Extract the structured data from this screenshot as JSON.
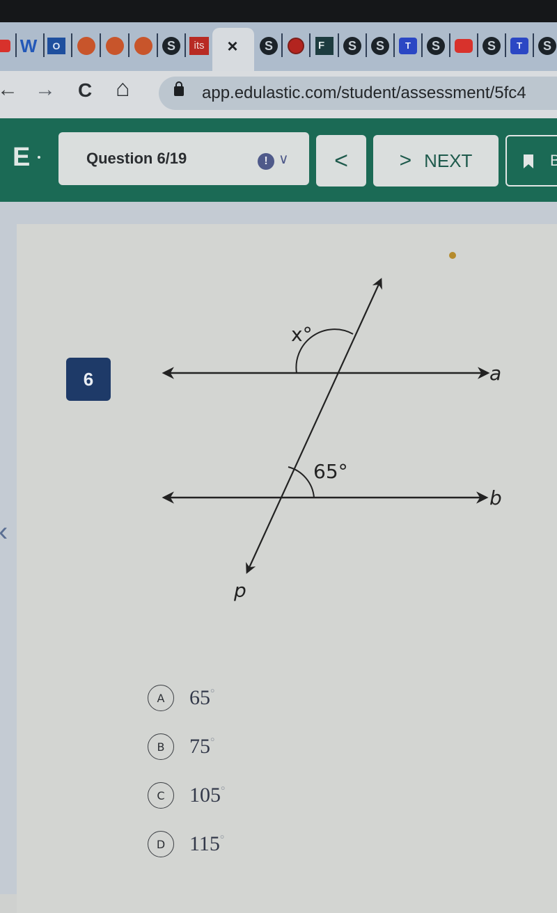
{
  "browser": {
    "tabs": [
      {
        "icon": "youtube-icon"
      },
      {
        "icon": "word-icon",
        "label": "W"
      },
      {
        "icon": "outlook-icon",
        "label": "O"
      },
      {
        "icon": "orange-dot-icon"
      },
      {
        "icon": "orange-dot-icon"
      },
      {
        "icon": "orange-dot-icon"
      },
      {
        "icon": "globe-icon"
      },
      {
        "icon": "its-icon",
        "label": "its"
      },
      {
        "icon": "close-icon",
        "label": "×",
        "active": true
      },
      {
        "icon": "globe-icon"
      },
      {
        "icon": "record-icon"
      },
      {
        "icon": "forms-icon",
        "label": "F"
      },
      {
        "icon": "globe-icon"
      },
      {
        "icon": "globe-icon"
      },
      {
        "icon": "teams-icon",
        "label": "T"
      },
      {
        "icon": "globe-icon"
      },
      {
        "icon": "youtube-icon"
      },
      {
        "icon": "globe-icon"
      },
      {
        "icon": "teams-icon",
        "label": "T"
      },
      {
        "icon": "globe-icon"
      }
    ],
    "nav": {
      "back": "←",
      "forward": "→",
      "reload": "C",
      "home": "⌂"
    },
    "url": "app.edulastic.com/student/assessment/5fc4"
  },
  "app": {
    "logo": "E",
    "question_selector": "Question 6/19",
    "alert_icon": "!",
    "dropdown_icon": "∨",
    "prev_label": "<",
    "next_arrow": ">",
    "next_label": "NEXT",
    "bookmark_label": "B"
  },
  "question": {
    "number": "6",
    "diagram": {
      "lines": [
        "a",
        "b",
        "p"
      ],
      "angle_unknown": "x°",
      "angle_given": "65°"
    },
    "options": [
      {
        "letter": "A",
        "value": "65",
        "unit": "°"
      },
      {
        "letter": "B",
        "value": "75",
        "unit": "°"
      },
      {
        "letter": "C",
        "value": "105",
        "unit": "°"
      },
      {
        "letter": "D",
        "value": "115",
        "unit": "°"
      }
    ]
  },
  "colors": {
    "appbar": "#1b6a55",
    "question_badge": "#1e3a68"
  }
}
